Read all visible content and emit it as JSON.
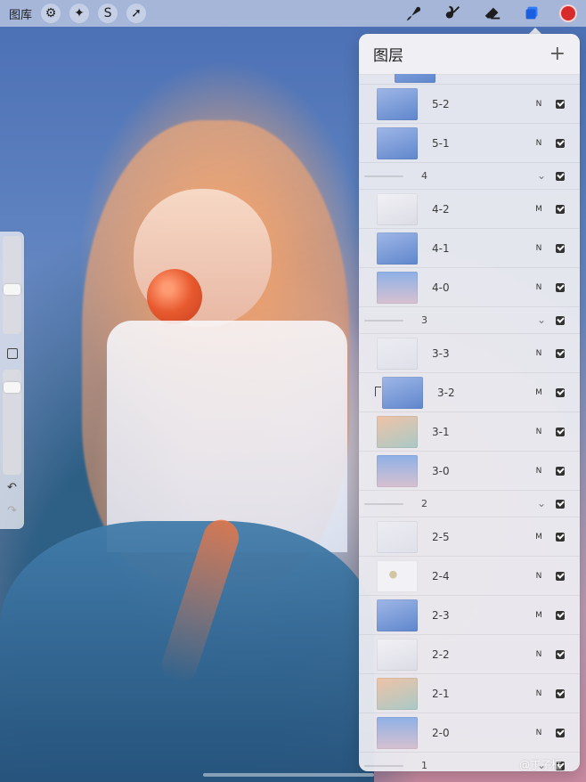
{
  "topbar": {
    "gallery_label": "图库",
    "actions": [
      {
        "icon": "wrench-icon",
        "glyph": "⚙"
      },
      {
        "icon": "magic-wand-icon",
        "glyph": "✦"
      },
      {
        "icon": "selection-s-icon",
        "glyph": "S"
      },
      {
        "icon": "transform-arrow-icon",
        "glyph": "➚"
      }
    ],
    "tools": [
      {
        "icon": "brush-icon"
      },
      {
        "icon": "smudge-icon"
      },
      {
        "icon": "eraser-icon"
      },
      {
        "icon": "layers-icon"
      }
    ],
    "color": "#d72b2b"
  },
  "sidebar": {
    "undo_glyph": "↶",
    "redo_glyph": "↷"
  },
  "layers_panel": {
    "title": "图层",
    "add_glyph": "+",
    "rows": [
      {
        "kind": "clip"
      },
      {
        "kind": "layer",
        "name": "5-2",
        "mode": "N",
        "thumb": "blue"
      },
      {
        "kind": "layer",
        "name": "5-1",
        "mode": "N",
        "thumb": "blue"
      },
      {
        "kind": "group",
        "name": "4",
        "chevron": "⌄"
      },
      {
        "kind": "layer",
        "name": "4-2",
        "mode": "M",
        "thumb": "sketch"
      },
      {
        "kind": "layer",
        "name": "4-1",
        "mode": "N",
        "thumb": "blue"
      },
      {
        "kind": "layer",
        "name": "4-0",
        "mode": "N",
        "thumb": "sky"
      },
      {
        "kind": "group",
        "name": "3",
        "chevron": "⌄"
      },
      {
        "kind": "layer",
        "name": "3-3",
        "mode": "N",
        "thumb": "blank"
      },
      {
        "kind": "layer",
        "name": "3-2",
        "mode": "M",
        "thumb": "blue",
        "clipped": true
      },
      {
        "kind": "layer",
        "name": "3-1",
        "mode": "N",
        "thumb": "peach"
      },
      {
        "kind": "layer",
        "name": "3-0",
        "mode": "N",
        "thumb": "sky"
      },
      {
        "kind": "group",
        "name": "2",
        "chevron": "⌄"
      },
      {
        "kind": "layer",
        "name": "2-5",
        "mode": "M",
        "thumb": "blank"
      },
      {
        "kind": "layer",
        "name": "2-4",
        "mode": "N",
        "thumb": "spot"
      },
      {
        "kind": "layer",
        "name": "2-3",
        "mode": "M",
        "thumb": "blue"
      },
      {
        "kind": "layer",
        "name": "2-2",
        "mode": "N",
        "thumb": "sketch"
      },
      {
        "kind": "layer",
        "name": "2-1",
        "mode": "N",
        "thumb": "peach"
      },
      {
        "kind": "layer",
        "name": "2-0",
        "mode": "N",
        "thumb": "sky"
      },
      {
        "kind": "group",
        "name": "1",
        "chevron": "⌄"
      }
    ]
  },
  "watermark": "@丁子框"
}
